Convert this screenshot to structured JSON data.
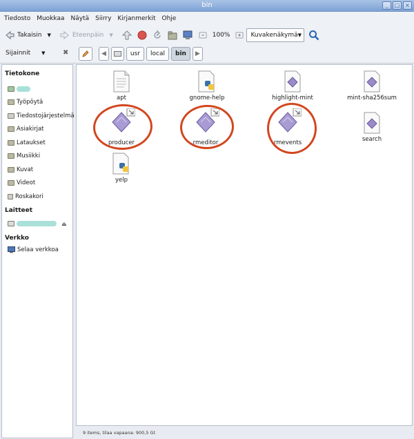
{
  "window": {
    "title": "bin"
  },
  "menu": [
    "Tiedosto",
    "Muokkaa",
    "Näytä",
    "Siirry",
    "Kirjanmerkit",
    "Ohje"
  ],
  "toolbar": {
    "back_label": "Takaisin",
    "forward_label": "Eteenpäin",
    "zoom": "100%",
    "view_mode": "Kuvakenäkymä"
  },
  "location": {
    "places_label": "Sijainnit",
    "crumbs": [
      "usr",
      "local",
      "bin"
    ]
  },
  "sidebar": {
    "computer_header": "Tietokone",
    "computer_items": [
      "Työpöytä",
      "Tiedostojärjestelmä",
      "Asiakirjat",
      "Lataukset",
      "Musiikki",
      "Kuvat",
      "Videot",
      "Roskakori"
    ],
    "devices_header": "Laitteet",
    "network_header": "Verkko",
    "network_items": [
      "Selaa verkkoa"
    ]
  },
  "files": [
    {
      "name": "apt",
      "icon": "text-file-icon"
    },
    {
      "name": "gnome-help",
      "icon": "python-script-icon"
    },
    {
      "name": "highlight-mint",
      "icon": "executable-icon"
    },
    {
      "name": "mint-sha256sum",
      "icon": "executable-icon"
    },
    {
      "name": "producer",
      "icon": "executable-link-icon"
    },
    {
      "name": "rmeditor",
      "icon": "executable-link-icon"
    },
    {
      "name": "rmevents",
      "icon": "executable-link-icon"
    },
    {
      "name": "search",
      "icon": "executable-icon"
    },
    {
      "name": "yelp",
      "icon": "python-script-icon"
    }
  ],
  "status": "9 items, tilaa vapaana: 900,5 Gt",
  "colors": {
    "annotation": "#d2461f",
    "titlebar": "#8fb0de",
    "exec_icon": "#9a8ac6"
  }
}
